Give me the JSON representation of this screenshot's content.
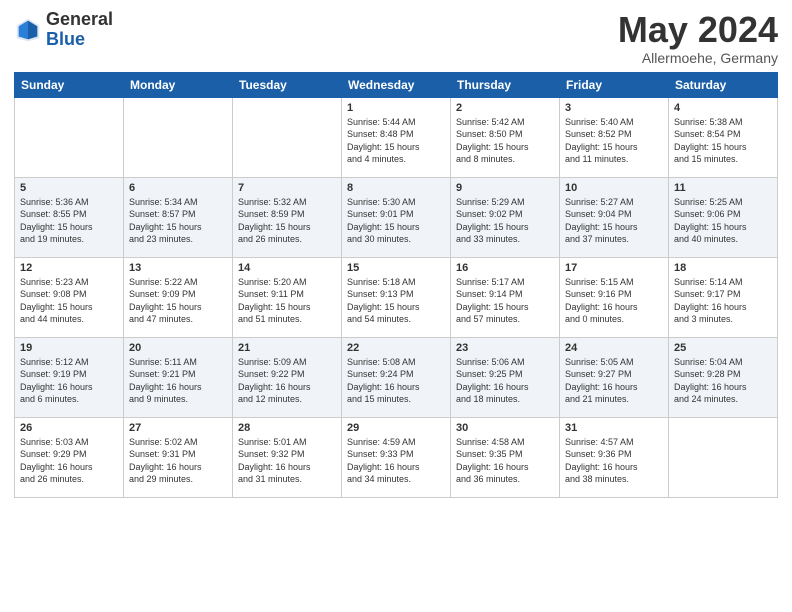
{
  "header": {
    "logo_general": "General",
    "logo_blue": "Blue",
    "title": "May 2024",
    "subtitle": "Allermoehe, Germany"
  },
  "days_of_week": [
    "Sunday",
    "Monday",
    "Tuesday",
    "Wednesday",
    "Thursday",
    "Friday",
    "Saturday"
  ],
  "weeks": [
    [
      {
        "day": "",
        "info": ""
      },
      {
        "day": "",
        "info": ""
      },
      {
        "day": "",
        "info": ""
      },
      {
        "day": "1",
        "info": "Sunrise: 5:44 AM\nSunset: 8:48 PM\nDaylight: 15 hours\nand 4 minutes."
      },
      {
        "day": "2",
        "info": "Sunrise: 5:42 AM\nSunset: 8:50 PM\nDaylight: 15 hours\nand 8 minutes."
      },
      {
        "day": "3",
        "info": "Sunrise: 5:40 AM\nSunset: 8:52 PM\nDaylight: 15 hours\nand 11 minutes."
      },
      {
        "day": "4",
        "info": "Sunrise: 5:38 AM\nSunset: 8:54 PM\nDaylight: 15 hours\nand 15 minutes."
      }
    ],
    [
      {
        "day": "5",
        "info": "Sunrise: 5:36 AM\nSunset: 8:55 PM\nDaylight: 15 hours\nand 19 minutes."
      },
      {
        "day": "6",
        "info": "Sunrise: 5:34 AM\nSunset: 8:57 PM\nDaylight: 15 hours\nand 23 minutes."
      },
      {
        "day": "7",
        "info": "Sunrise: 5:32 AM\nSunset: 8:59 PM\nDaylight: 15 hours\nand 26 minutes."
      },
      {
        "day": "8",
        "info": "Sunrise: 5:30 AM\nSunset: 9:01 PM\nDaylight: 15 hours\nand 30 minutes."
      },
      {
        "day": "9",
        "info": "Sunrise: 5:29 AM\nSunset: 9:02 PM\nDaylight: 15 hours\nand 33 minutes."
      },
      {
        "day": "10",
        "info": "Sunrise: 5:27 AM\nSunset: 9:04 PM\nDaylight: 15 hours\nand 37 minutes."
      },
      {
        "day": "11",
        "info": "Sunrise: 5:25 AM\nSunset: 9:06 PM\nDaylight: 15 hours\nand 40 minutes."
      }
    ],
    [
      {
        "day": "12",
        "info": "Sunrise: 5:23 AM\nSunset: 9:08 PM\nDaylight: 15 hours\nand 44 minutes."
      },
      {
        "day": "13",
        "info": "Sunrise: 5:22 AM\nSunset: 9:09 PM\nDaylight: 15 hours\nand 47 minutes."
      },
      {
        "day": "14",
        "info": "Sunrise: 5:20 AM\nSunset: 9:11 PM\nDaylight: 15 hours\nand 51 minutes."
      },
      {
        "day": "15",
        "info": "Sunrise: 5:18 AM\nSunset: 9:13 PM\nDaylight: 15 hours\nand 54 minutes."
      },
      {
        "day": "16",
        "info": "Sunrise: 5:17 AM\nSunset: 9:14 PM\nDaylight: 15 hours\nand 57 minutes."
      },
      {
        "day": "17",
        "info": "Sunrise: 5:15 AM\nSunset: 9:16 PM\nDaylight: 16 hours\nand 0 minutes."
      },
      {
        "day": "18",
        "info": "Sunrise: 5:14 AM\nSunset: 9:17 PM\nDaylight: 16 hours\nand 3 minutes."
      }
    ],
    [
      {
        "day": "19",
        "info": "Sunrise: 5:12 AM\nSunset: 9:19 PM\nDaylight: 16 hours\nand 6 minutes."
      },
      {
        "day": "20",
        "info": "Sunrise: 5:11 AM\nSunset: 9:21 PM\nDaylight: 16 hours\nand 9 minutes."
      },
      {
        "day": "21",
        "info": "Sunrise: 5:09 AM\nSunset: 9:22 PM\nDaylight: 16 hours\nand 12 minutes."
      },
      {
        "day": "22",
        "info": "Sunrise: 5:08 AM\nSunset: 9:24 PM\nDaylight: 16 hours\nand 15 minutes."
      },
      {
        "day": "23",
        "info": "Sunrise: 5:06 AM\nSunset: 9:25 PM\nDaylight: 16 hours\nand 18 minutes."
      },
      {
        "day": "24",
        "info": "Sunrise: 5:05 AM\nSunset: 9:27 PM\nDaylight: 16 hours\nand 21 minutes."
      },
      {
        "day": "25",
        "info": "Sunrise: 5:04 AM\nSunset: 9:28 PM\nDaylight: 16 hours\nand 24 minutes."
      }
    ],
    [
      {
        "day": "26",
        "info": "Sunrise: 5:03 AM\nSunset: 9:29 PM\nDaylight: 16 hours\nand 26 minutes."
      },
      {
        "day": "27",
        "info": "Sunrise: 5:02 AM\nSunset: 9:31 PM\nDaylight: 16 hours\nand 29 minutes."
      },
      {
        "day": "28",
        "info": "Sunrise: 5:01 AM\nSunset: 9:32 PM\nDaylight: 16 hours\nand 31 minutes."
      },
      {
        "day": "29",
        "info": "Sunrise: 4:59 AM\nSunset: 9:33 PM\nDaylight: 16 hours\nand 34 minutes."
      },
      {
        "day": "30",
        "info": "Sunrise: 4:58 AM\nSunset: 9:35 PM\nDaylight: 16 hours\nand 36 minutes."
      },
      {
        "day": "31",
        "info": "Sunrise: 4:57 AM\nSunset: 9:36 PM\nDaylight: 16 hours\nand 38 minutes."
      },
      {
        "day": "",
        "info": ""
      }
    ]
  ]
}
